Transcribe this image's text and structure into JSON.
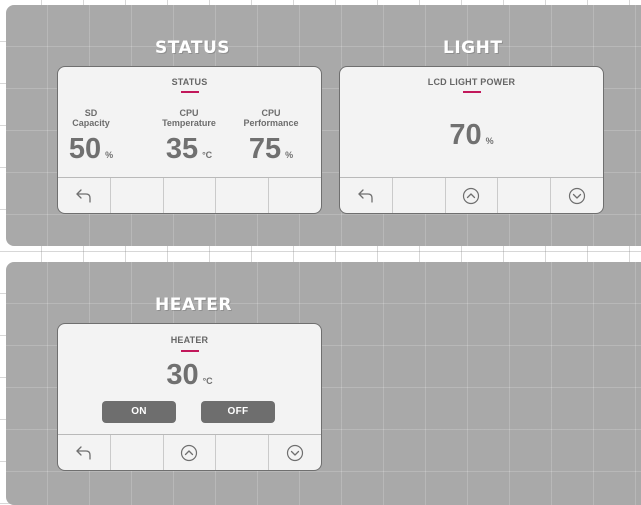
{
  "status": {
    "section_title": "STATUS",
    "panel_title": "STATUS",
    "metrics": [
      {
        "label": "SD\nCapacity",
        "value": "50",
        "unit": "%"
      },
      {
        "label": "CPU\nTemperature",
        "value": "35",
        "unit": "°C"
      },
      {
        "label": "CPU\nPerformance",
        "value": "75",
        "unit": "%"
      }
    ],
    "toolbar": [
      "back-arrow-icon",
      "",
      "",
      "",
      ""
    ]
  },
  "light": {
    "section_title": "LIGHT",
    "panel_title": "LCD LIGHT POWER",
    "value": "70",
    "unit": "%",
    "toolbar": [
      "back-arrow-icon",
      "",
      "chevron-up-circle-icon",
      "",
      "chevron-down-circle-icon"
    ]
  },
  "heater": {
    "section_title": "HEATER",
    "panel_title": "HEATER",
    "value": "30",
    "unit": "°C",
    "on_label": "ON",
    "off_label": "OFF",
    "toolbar": [
      "back-arrow-icon",
      "",
      "chevron-up-circle-icon",
      "",
      "chevron-down-circle-icon"
    ]
  },
  "colors": {
    "band": "#a9a9a9",
    "panel": "#f3f3f3",
    "accent_underline": "#c2185b",
    "value_text": "#707070",
    "pill": "#6e6e6e"
  }
}
